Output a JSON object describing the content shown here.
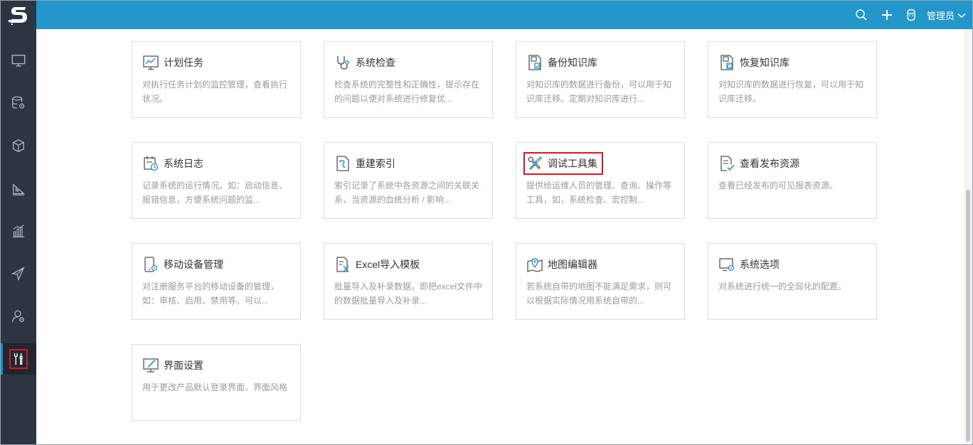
{
  "user": {
    "name": "管理员"
  },
  "nav": {
    "items": [
      {
        "icon": "monitor-icon",
        "active": false
      },
      {
        "icon": "database-gear-icon",
        "active": false
      },
      {
        "icon": "cube-icon",
        "active": false
      },
      {
        "icon": "ruler-triangle-icon",
        "active": false
      },
      {
        "icon": "bar-chart-icon",
        "active": false
      },
      {
        "icon": "paper-plane-icon",
        "active": false
      },
      {
        "icon": "user-gear-icon",
        "active": false
      },
      {
        "icon": "tools-icon",
        "active": true
      }
    ]
  },
  "colors": {
    "topbar": "#2397c9",
    "sidebar": "#2c3643",
    "highlight": "#e0141e",
    "accent": "#1e90c8"
  },
  "cards": [
    {
      "title": "计划任务",
      "desc": "对执行任务计划的监控管理，查看执行状况。",
      "icon": "line-chart-icon"
    },
    {
      "title": "系统检查",
      "desc": "检查系统的完整性和正确性，提示存在的问题以便对系统进行修复优...",
      "icon": "stethoscope-icon"
    },
    {
      "title": "备份知识库",
      "desc": "对知识库的数据进行备份，可以用于知识库迁移。定期对知识库进行...",
      "icon": "backup-icon"
    },
    {
      "title": "恢复知识库",
      "desc": "对知识库的数据进行恢复，可以用于知识库迁移。",
      "icon": "restore-icon"
    },
    {
      "title": "系统日志",
      "desc": "记录系统的运行情况。如：启动信息、报错信息，方便系统问题的监...",
      "icon": "calendar-clock-icon"
    },
    {
      "title": "重建索引",
      "desc": "索引记录了系统中各资源之间的关联关系，当资源的血统分析 / 影响...",
      "icon": "index-icon"
    },
    {
      "title": "调试工具集",
      "desc": "提供给运维人员的管理、查询、操作等工具，如，系统检查、宏控制...",
      "icon": "wrench-screwdriver-icon",
      "highlighted": true
    },
    {
      "title": "查看发布资源",
      "desc": "查看已经发布的可见报表资源。",
      "icon": "document-check-icon"
    },
    {
      "title": "移动设备管理",
      "desc": "对注册服务平台的移动设备的管理，如：审核、启用、禁用等。可以...",
      "icon": "mobile-gear-icon"
    },
    {
      "title": "Excel导入模板",
      "desc": "批量导入及补录数据，即把excel文件中的数据批量导入及补录...",
      "icon": "excel-import-icon"
    },
    {
      "title": "地图编辑器",
      "desc": "若系统自带的地图不能满足需求，则可以根据实际情况用系统自带的...",
      "icon": "map-pin-icon"
    },
    {
      "title": "系统选项",
      "desc": "对系统进行统一的全局化的配置。",
      "icon": "monitor-gear-icon"
    },
    {
      "title": "界面设置",
      "desc": "用于更改产品默认登录界面、界面风格",
      "icon": "screen-brush-icon"
    }
  ]
}
